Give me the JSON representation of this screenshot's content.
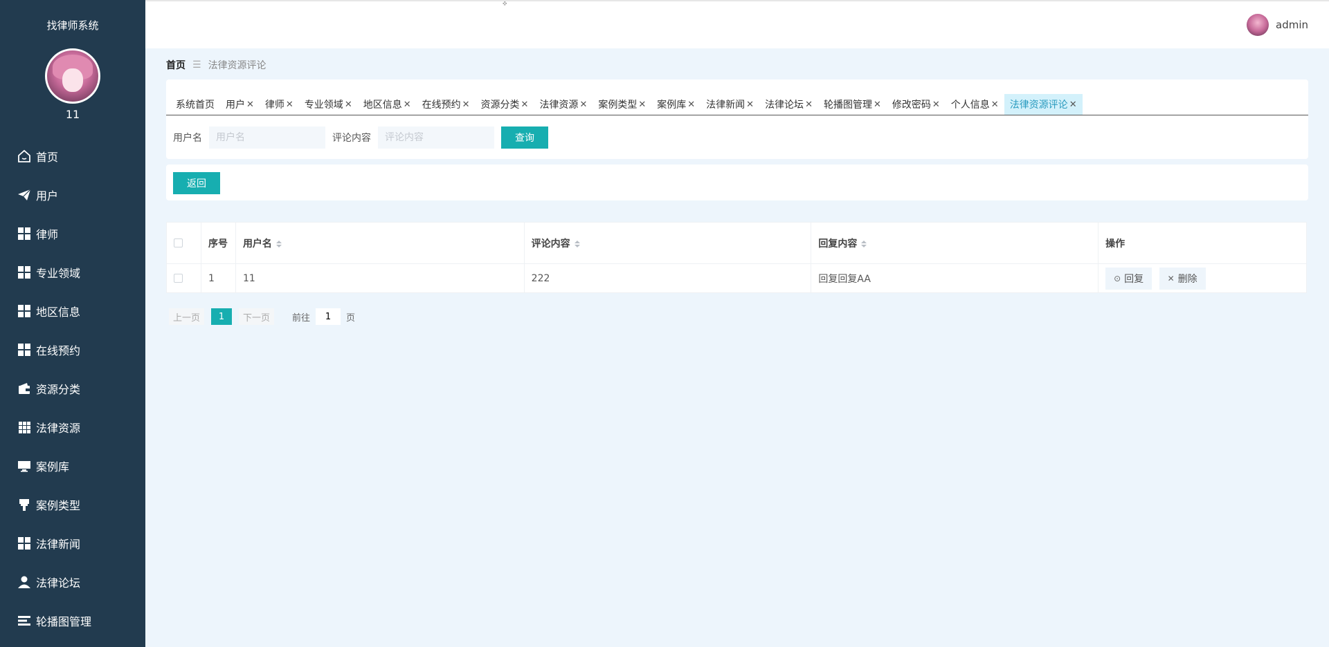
{
  "sidebar": {
    "system_title": "找律师系统",
    "user_number": "11",
    "items": [
      {
        "label": "首页",
        "icon": "home-icon"
      },
      {
        "label": "用户",
        "icon": "paper-plane-icon"
      },
      {
        "label": "律师",
        "icon": "grid-icon"
      },
      {
        "label": "专业领域",
        "icon": "grid-icon"
      },
      {
        "label": "地区信息",
        "icon": "grid-icon"
      },
      {
        "label": "在线预约",
        "icon": "grid-icon"
      },
      {
        "label": "资源分类",
        "icon": "wallet-icon"
      },
      {
        "label": "法律资源",
        "icon": "grid-nine-icon"
      },
      {
        "label": "案例库",
        "icon": "monitor-icon"
      },
      {
        "label": "案例类型",
        "icon": "brush-icon"
      },
      {
        "label": "法律新闻",
        "icon": "grid-icon"
      },
      {
        "label": "法律论坛",
        "icon": "user-icon"
      },
      {
        "label": "轮播图管理",
        "icon": "slides-icon"
      }
    ]
  },
  "header": {
    "username": "admin"
  },
  "breadcrumb": {
    "home": "首页",
    "separator": "☰",
    "current": "法律资源评论"
  },
  "tabs": [
    {
      "label": "系统首页",
      "closable": false
    },
    {
      "label": "用户",
      "closable": true
    },
    {
      "label": "律师",
      "closable": true
    },
    {
      "label": "专业领域",
      "closable": true
    },
    {
      "label": "地区信息",
      "closable": true
    },
    {
      "label": "在线预约",
      "closable": true
    },
    {
      "label": "资源分类",
      "closable": true
    },
    {
      "label": "法律资源",
      "closable": true
    },
    {
      "label": "案例类型",
      "closable": true
    },
    {
      "label": "案例库",
      "closable": true
    },
    {
      "label": "法律新闻",
      "closable": true
    },
    {
      "label": "法律论坛",
      "closable": true
    },
    {
      "label": "轮播图管理",
      "closable": true
    },
    {
      "label": "修改密码",
      "closable": true
    },
    {
      "label": "个人信息",
      "closable": true
    },
    {
      "label": "法律资源评论",
      "closable": true,
      "active": true
    }
  ],
  "search": {
    "username_label": "用户名",
    "username_placeholder": "用户名",
    "username_value": "",
    "content_label": "评论内容",
    "content_placeholder": "评论内容",
    "content_value": "",
    "query_button": "查询"
  },
  "actions": {
    "back_button": "返回"
  },
  "table": {
    "columns": [
      "序号",
      "用户名",
      "评论内容",
      "回复内容",
      "操作"
    ],
    "rows": [
      {
        "index": "1",
        "username": "11",
        "content": "222",
        "reply": "回复回复AA"
      }
    ],
    "reply_button": "回复",
    "delete_button": "删除"
  },
  "pager": {
    "prev": "上一页",
    "current": "1",
    "next": "下一页",
    "goto_prefix": "前往",
    "goto_value": "1",
    "goto_suffix": "页"
  },
  "colors": {
    "sidebar_bg": "#223b4f",
    "accent": "#17aeb0",
    "page_bg": "#edf5fc"
  }
}
